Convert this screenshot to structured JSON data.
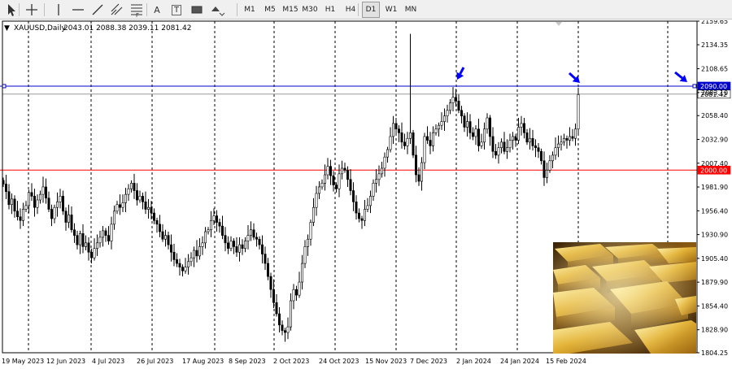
{
  "toolbar": {
    "tools": [
      {
        "name": "cursor-arrow-icon"
      },
      {
        "name": "crosshair-icon"
      },
      {
        "name": "vertical-line-icon"
      },
      {
        "name": "horizontal-line-icon"
      },
      {
        "name": "trendline-icon"
      },
      {
        "name": "equidistant-channel-icon"
      },
      {
        "name": "fibonacci-icon"
      },
      {
        "name": "text-tool-icon",
        "label": "A"
      },
      {
        "name": "text-label-tool-icon",
        "label": "T"
      },
      {
        "name": "rectangle-icon"
      },
      {
        "name": "shapes-menu-icon"
      }
    ],
    "timeframes": [
      "M1",
      "M5",
      "M15",
      "M30",
      "H1",
      "H4",
      "D1",
      "W1",
      "MN"
    ],
    "active_timeframe": "D1"
  },
  "chart_data": {
    "type": "candlestick",
    "symbol_header": "XAUUSD,Daily",
    "ohlc_header": "2043.01 2088.38 2039.11 2081.42",
    "y_ticks": [
      "2159.65",
      "2134.35",
      "2108.65",
      "2083.10",
      "2058.40",
      "2032.90",
      "2007.40",
      "1981.90",
      "1956.40",
      "1930.90",
      "1905.40",
      "1879.90",
      "1854.40",
      "1828.90",
      "1804.25"
    ],
    "x_ticks": [
      "19 May 2023",
      "12 Jun 2023",
      "4 Jul 2023",
      "26 Jul 2023",
      "17 Aug 2023",
      "8 Sep 2023",
      "2 Oct 2023",
      "24 Oct 2023",
      "15 Nov 2023",
      "7 Dec 2023",
      "2 Jan 2024",
      "24 Jan 2024",
      "15 Feb 2024"
    ],
    "ylim": [
      1804.25,
      2159.65
    ],
    "closes": [
      1985,
      1977,
      1963,
      1969,
      1956,
      1950,
      1946,
      1958,
      1962,
      1976,
      1972,
      1960,
      1968,
      1974,
      1982,
      1970,
      1958,
      1948,
      1960,
      1966,
      1972,
      1956,
      1944,
      1952,
      1936,
      1930,
      1920,
      1932,
      1918,
      1922,
      1912,
      1906,
      1916,
      1922,
      1928,
      1935,
      1930,
      1924,
      1942,
      1956,
      1963,
      1960,
      1965,
      1974,
      1980,
      1986,
      1978,
      1968,
      1972,
      1966,
      1958,
      1960,
      1954,
      1946,
      1942,
      1934,
      1926,
      1930,
      1920,
      1912,
      1904,
      1900,
      1896,
      1892,
      1896,
      1902,
      1906,
      1914,
      1908,
      1918,
      1922,
      1934,
      1936,
      1946,
      1951,
      1944,
      1940,
      1930,
      1922,
      1916,
      1924,
      1918,
      1912,
      1920,
      1916,
      1924,
      1930,
      1936,
      1928,
      1926,
      1920,
      1910,
      1900,
      1886,
      1872,
      1858,
      1846,
      1834,
      1828,
      1826,
      1832,
      1860,
      1872,
      1866,
      1880,
      1900,
      1918,
      1926,
      1944,
      1960,
      1975,
      1982,
      1986,
      1995,
      2004,
      1994,
      1984,
      1980,
      1996,
      2002,
      2000,
      1990,
      1978,
      1966,
      1954,
      1948,
      1946,
      1958,
      1962,
      1972,
      1986,
      1990,
      1996,
      2002,
      2014,
      2022,
      2036,
      2050,
      2044,
      2040,
      2030,
      2026,
      2034,
      2040,
      2016,
      1995,
      1988,
      2008,
      2036,
      2032,
      2026,
      2040,
      2044,
      2048,
      2052,
      2058,
      2064,
      2072,
      2078,
      2074,
      2064,
      2058,
      2046,
      2052,
      2040,
      2036,
      2044,
      2026,
      2030,
      2044,
      2056,
      2036,
      2020,
      2016,
      2024,
      2030,
      2020,
      2024,
      2032,
      2036,
      2032,
      2046,
      2050,
      2040,
      2030,
      2034,
      2026,
      2024,
      2020,
      2010,
      1992,
      2000,
      2010,
      2016,
      2024,
      2028,
      2030,
      2034,
      2032,
      2036,
      2034,
      2044,
      2081
    ],
    "levels": [
      {
        "price": 2090.0,
        "label": "2090.00",
        "color": "#0000cd"
      },
      {
        "price": 2000.0,
        "label": "2000.00",
        "color": "#ff0000"
      },
      {
        "price": 2081.42,
        "label": "2081.42",
        "color": "#9a9a9a"
      }
    ],
    "colors": {
      "candle": "#000000",
      "grid": "#000000",
      "arrow": "#0000ff",
      "up_body": "#ffffff",
      "down_body": "#000000"
    }
  }
}
